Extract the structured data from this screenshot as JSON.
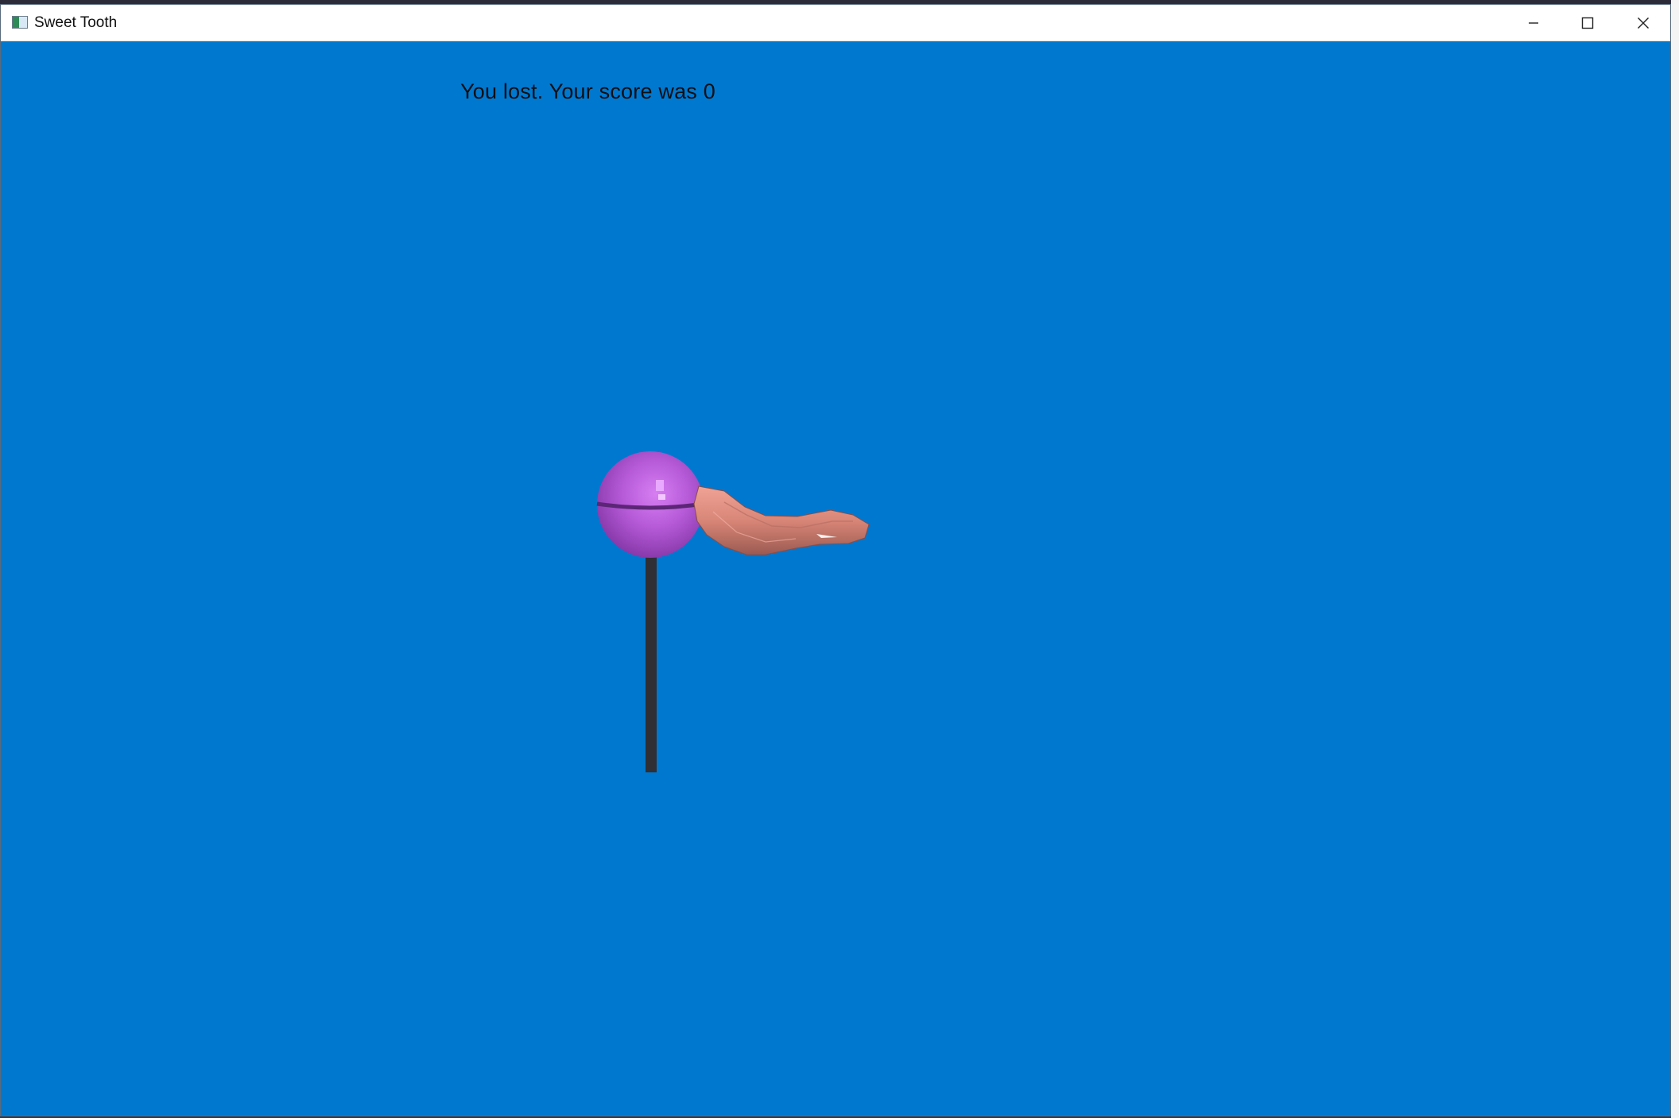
{
  "window": {
    "title": "Sweet Tooth",
    "icon": "app-window-icon",
    "controls": {
      "minimize_icon": "minimize-icon",
      "maximize_icon": "maximize-icon",
      "close_icon": "close-icon"
    }
  },
  "game": {
    "status_text": "You lost. Your score was 0",
    "background_color": "#0078cf",
    "objects": [
      {
        "name": "lollipop",
        "candy_color": "#b04fd0",
        "stick_color": "#2f2f35"
      },
      {
        "name": "arm",
        "skin_color": "#d98a7e"
      }
    ]
  }
}
